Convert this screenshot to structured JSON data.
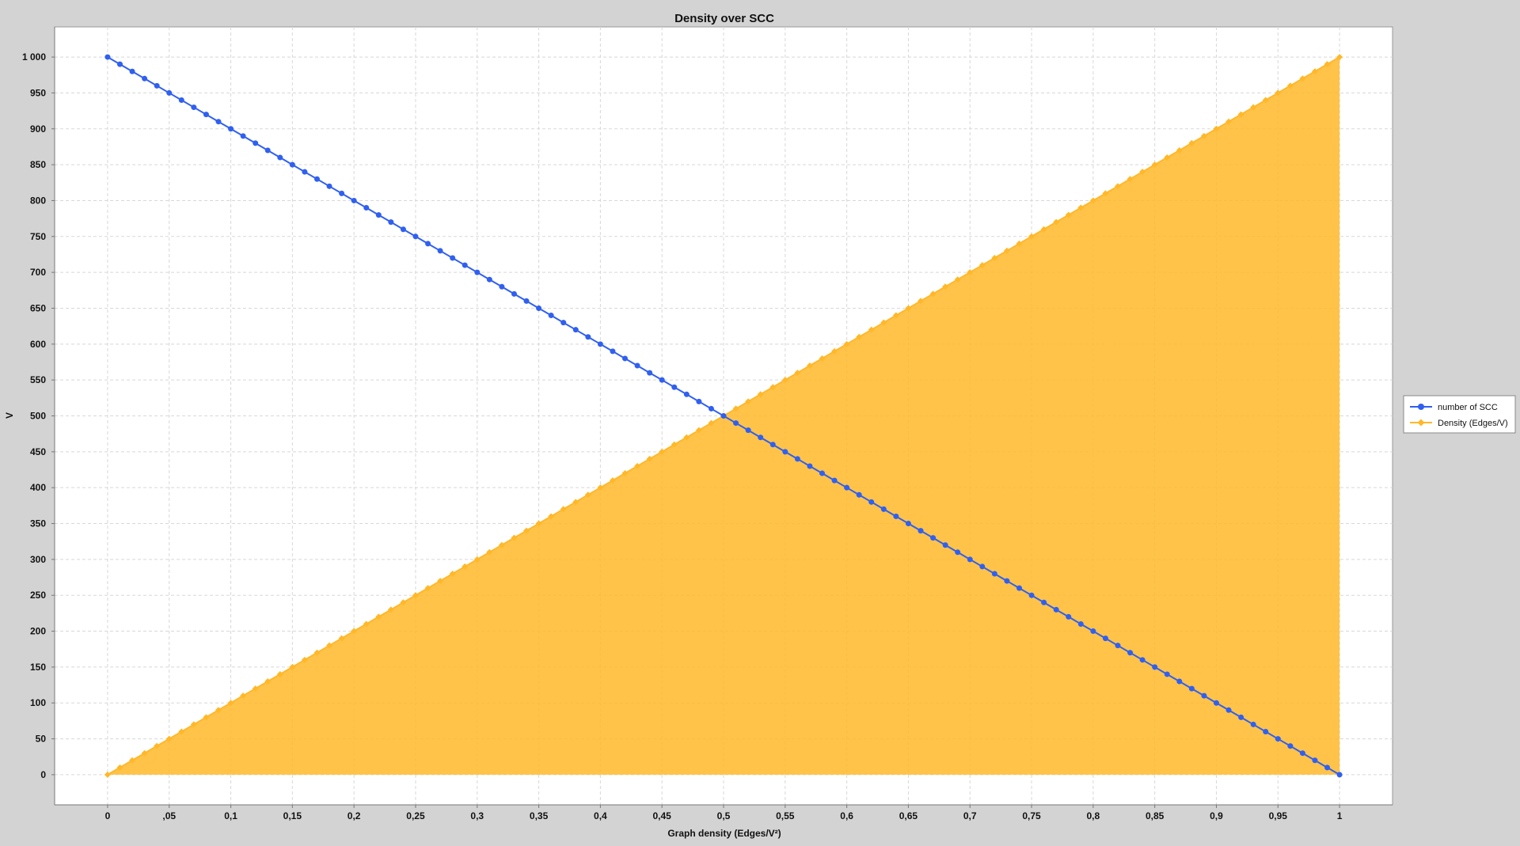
{
  "chart_data": {
    "type": "line",
    "title": "Density over SCC",
    "xlabel": "Graph density (Edges/V²)",
    "ylabel": "V",
    "xlim": [
      -0.043,
      1.043
    ],
    "ylim": [
      -42,
      1042
    ],
    "x_ticks": [
      "0",
      ",05",
      "0,1",
      "0,15",
      "0,2",
      "0,25",
      "0,3",
      "0,35",
      "0,4",
      "0,45",
      "0,5",
      "0,55",
      "0,6",
      "0,65",
      "0,7",
      "0,75",
      "0,8",
      "0,85",
      "0,9",
      "0,95",
      "1"
    ],
    "y_ticks": [
      "0",
      "50",
      "100",
      "150",
      "200",
      "250",
      "300",
      "350",
      "400",
      "450",
      "500",
      "550",
      "600",
      "650",
      "700",
      "750",
      "800",
      "850",
      "900",
      "950",
      "1 000"
    ],
    "grid": true,
    "legend_position": "right",
    "x_start": 0,
    "x_step": 0.01,
    "series": [
      {
        "name": "number of SCC",
        "color": "#3060f0",
        "marker": "circle",
        "style": "line",
        "values": [
          1000,
          990,
          980,
          970,
          960,
          950,
          940,
          930,
          920,
          910,
          900,
          890,
          880,
          870,
          860,
          850,
          840,
          830,
          820,
          810,
          800,
          790,
          780,
          770,
          760,
          750,
          740,
          730,
          720,
          710,
          700,
          690,
          680,
          670,
          660,
          650,
          640,
          630,
          620,
          610,
          600,
          590,
          580,
          570,
          560,
          550,
          540,
          530,
          520,
          510,
          500,
          490,
          480,
          470,
          460,
          450,
          440,
          430,
          420,
          410,
          400,
          390,
          380,
          370,
          360,
          350,
          340,
          330,
          320,
          310,
          300,
          290,
          280,
          270,
          260,
          250,
          240,
          230,
          220,
          210,
          200,
          190,
          180,
          170,
          160,
          150,
          140,
          130,
          120,
          110,
          100,
          90,
          80,
          70,
          60,
          50,
          40,
          30,
          20,
          10,
          0
        ]
      },
      {
        "name": "Density (Edges/V)",
        "color": "#ffb829",
        "marker": "diamond",
        "style": "area",
        "values": [
          0,
          10,
          20,
          30,
          40,
          50,
          60,
          70,
          80,
          90,
          100,
          110,
          120,
          130,
          140,
          150,
          160,
          170,
          180,
          190,
          200,
          210,
          220,
          230,
          240,
          250,
          260,
          270,
          280,
          290,
          300,
          310,
          320,
          330,
          340,
          350,
          360,
          370,
          380,
          390,
          400,
          410,
          420,
          430,
          440,
          450,
          460,
          470,
          480,
          490,
          500,
          510,
          520,
          530,
          540,
          550,
          560,
          570,
          580,
          590,
          600,
          610,
          620,
          630,
          640,
          650,
          660,
          670,
          680,
          690,
          700,
          710,
          720,
          730,
          740,
          750,
          760,
          770,
          780,
          790,
          800,
          810,
          820,
          830,
          840,
          850,
          860,
          870,
          880,
          890,
          900,
          910,
          920,
          930,
          940,
          950,
          960,
          970,
          980,
          990,
          1000
        ]
      }
    ]
  }
}
